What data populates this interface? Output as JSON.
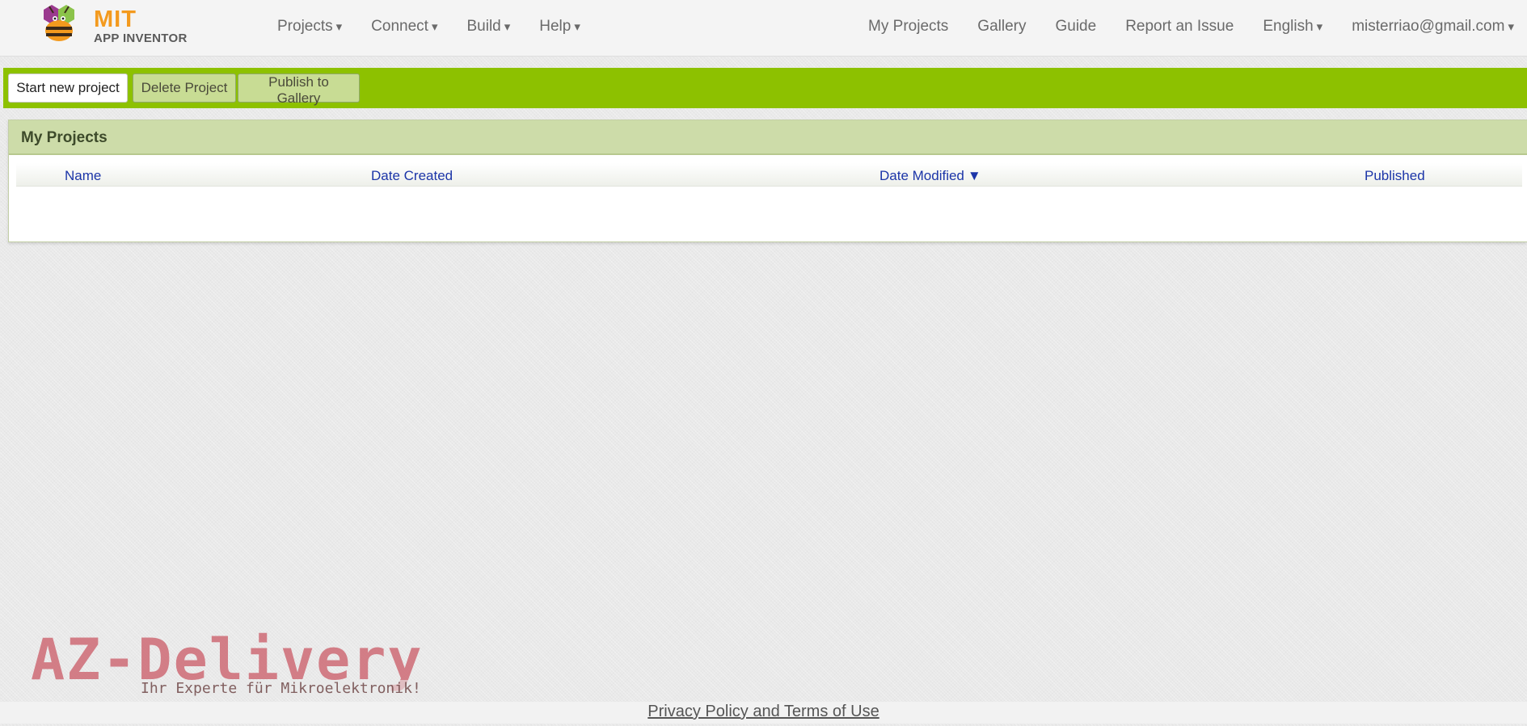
{
  "app": {
    "logo_title": "MIT",
    "logo_subtitle": "APP INVENTOR",
    "logo_icon": "app-inventor-bee-icon"
  },
  "nav": {
    "left": [
      {
        "label": "Projects",
        "caret": "▾"
      },
      {
        "label": "Connect",
        "caret": "▾"
      },
      {
        "label": "Build",
        "caret": "▾"
      },
      {
        "label": "Help",
        "caret": "▾"
      }
    ],
    "right": [
      {
        "label": "My Projects",
        "caret": ""
      },
      {
        "label": "Gallery",
        "caret": ""
      },
      {
        "label": "Guide",
        "caret": ""
      },
      {
        "label": "Report an Issue",
        "caret": ""
      },
      {
        "label": "English",
        "caret": "▾"
      },
      {
        "label": "misterriao@gmail.com",
        "caret": "▾"
      }
    ]
  },
  "toolbar": {
    "start_new": "Start new project",
    "delete": "Delete Project",
    "publish": "Publish to Gallery"
  },
  "projects": {
    "title": "My Projects",
    "columns": {
      "name": "Name",
      "date_created": "Date Created",
      "date_modified": "Date Modified",
      "sort_indicator": "▼",
      "published": "Published"
    },
    "rows": []
  },
  "watermark": {
    "brand": "AZ-Delivery",
    "tagline": "Ihr Experte für Mikroelektronik!"
  },
  "footer": {
    "link": "Privacy Policy and Terms of Use"
  },
  "colors": {
    "toolbar_green": "#8dc100",
    "panel_header": "#cddca9",
    "link_blue": "#1c35a8",
    "logo_orange": "#f39a1e"
  }
}
